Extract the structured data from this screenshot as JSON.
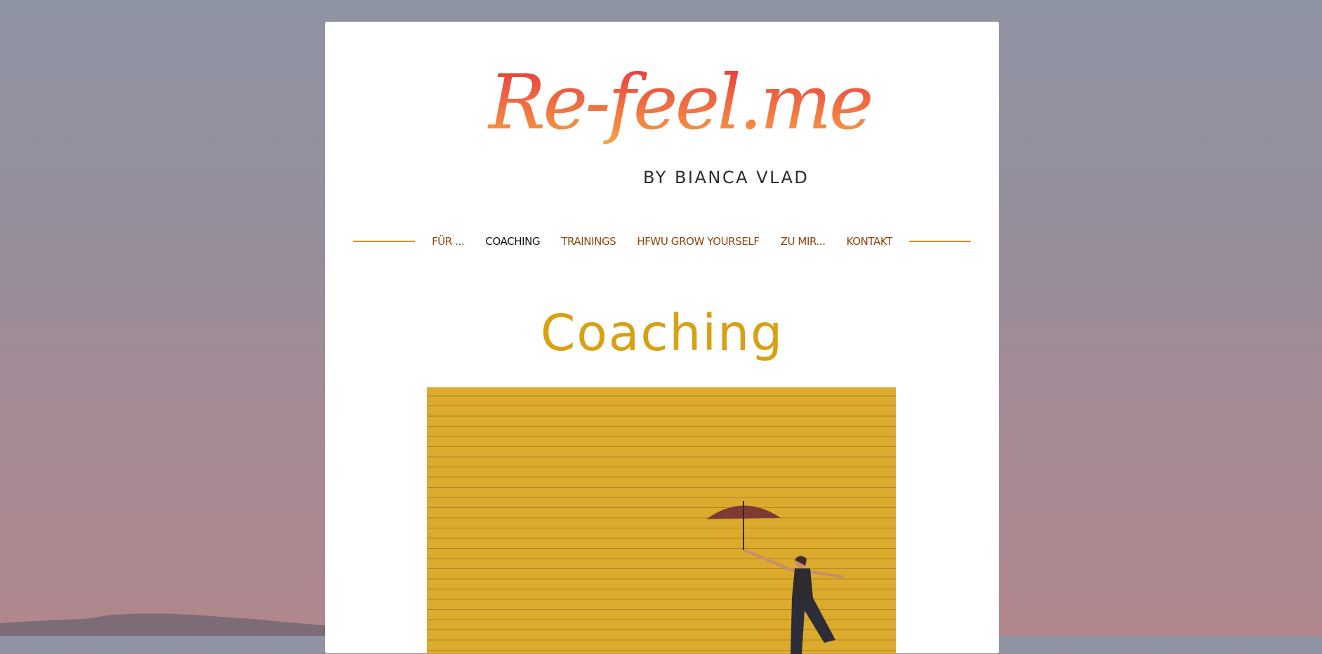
{
  "logo": {
    "wordmark": "Re-feel.me",
    "byline": "BY BIANCA VLAD"
  },
  "nav": {
    "items": [
      {
        "label": "FÜR ...",
        "active": false
      },
      {
        "label": "COACHING",
        "active": true
      },
      {
        "label": "TRAININGS",
        "active": false
      },
      {
        "label": "HFWU GROW YOURSELF",
        "active": false
      },
      {
        "label": "ZU MIR...",
        "active": false
      },
      {
        "label": "KONTAKT",
        "active": false
      }
    ]
  },
  "page": {
    "title": "Coaching"
  },
  "colors": {
    "accent_orange": "#e58b1c",
    "nav_text": "#8b4411",
    "nav_active": "#121212",
    "title": "#d9a011",
    "logo_gradient": [
      "#e8323f",
      "#f7a545"
    ],
    "hero_wall": "#dcab2e"
  },
  "icons": {
    "hero": "woman-with-umbrella-photo"
  }
}
